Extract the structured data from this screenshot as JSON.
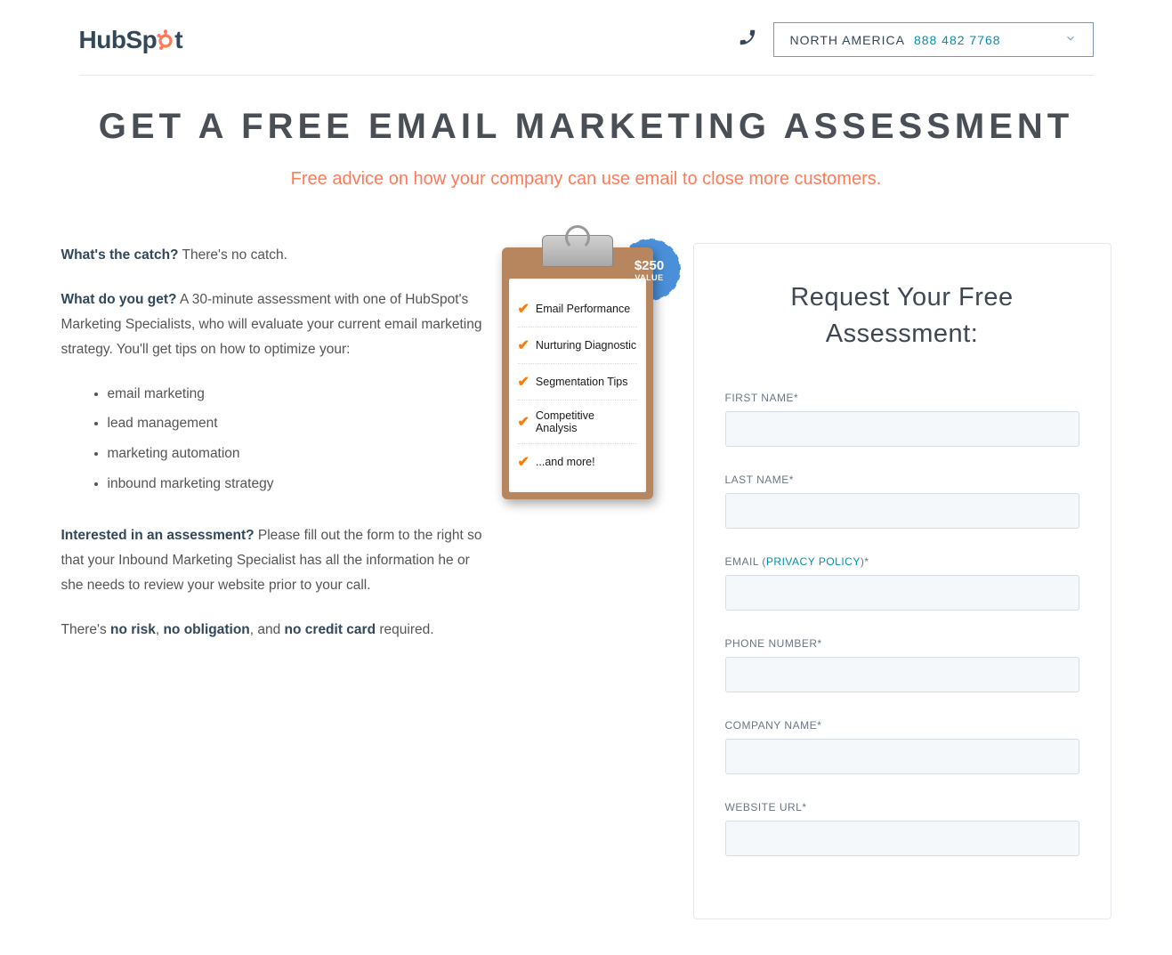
{
  "header": {
    "logo_prefix": "HubSp",
    "logo_suffix": "t",
    "region_label": "NORTH AMERICA",
    "phone": "888 482 7768"
  },
  "hero": {
    "title": "GET A FREE EMAIL MARKETING ASSESSMENT",
    "subtitle": "Free advice on how your company can use email to close more customers."
  },
  "body": {
    "q1_bold": "What's the catch?",
    "q1_text": " There's no catch.",
    "q2_bold": "What do you get?",
    "q2_text": " A 30-minute assessment with one of HubSpot's Marketing Specialists, who will evaluate your current email marketing strategy. You'll get tips on how to optimize your:",
    "bullets": [
      "email marketing",
      "lead management",
      "marketing automation",
      "inbound marketing strategy"
    ],
    "q3_bold": "Interested in an assessment?",
    "q3_text": " Please fill out the form to the right so that your Inbound Marketing Specialist has all the information he or she needs to review your website prior to your call.",
    "closing_pre": "There's ",
    "closing_b1": "no risk",
    "closing_sep1": ", ",
    "closing_b2": "no obligation",
    "closing_sep2": ", and ",
    "closing_b3": "no credit card",
    "closing_post": " required."
  },
  "clipboard": {
    "badge_price": "$250",
    "badge_value": "VALUE",
    "items": [
      "Email Performance",
      "Nurturing Diagnostic",
      "Segmentation Tips",
      "Competitive Analysis",
      "...and more!"
    ]
  },
  "form": {
    "heading": "Request Your Free Assessment:",
    "fields": {
      "first_name": "FIRST NAME*",
      "last_name": "LAST NAME*",
      "email_pre": "EMAIL (",
      "email_link": "PRIVACY POLICY",
      "email_post": ")*",
      "phone": "PHONE NUMBER*",
      "company": "COMPANY NAME*",
      "website": "WEBSITE URL*"
    }
  }
}
